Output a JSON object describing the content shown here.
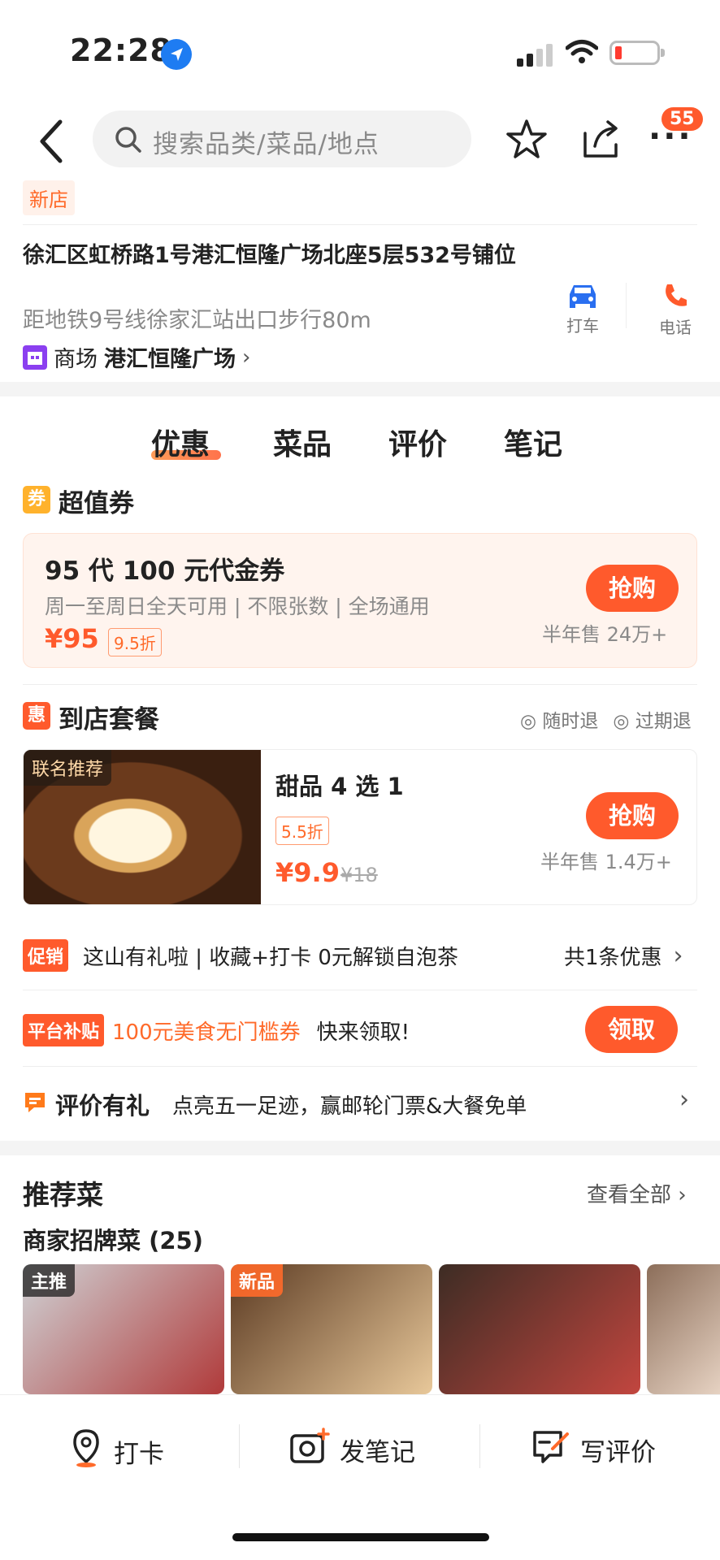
{
  "status": {
    "time": "22:28"
  },
  "header": {
    "search_placeholder": "搜索品类/菜品/地点",
    "more_badge": "55"
  },
  "store": {
    "new_tag": "新店",
    "address": "徐汇区虹桥路1号港汇恒隆广场北座5层532号铺位",
    "metro": "距地铁9号线徐家汇站出口步行80m",
    "mall_prefix": "商场",
    "mall_name": "港汇恒隆广场",
    "actions": {
      "taxi": "打车",
      "phone": "电话"
    }
  },
  "tabs": [
    {
      "label": "优惠",
      "active": true
    },
    {
      "label": "菜品"
    },
    {
      "label": "评价"
    },
    {
      "label": "笔记"
    }
  ],
  "voucher_section": {
    "icon": "券",
    "title": "超值券",
    "card": {
      "title": "95 代 100 元代金券",
      "desc": "周一至周日全天可用 | 不限张数 | 全场通用",
      "price": "¥95",
      "discount": "9.5折",
      "buy": "抢购",
      "sold": "半年售 24万+"
    }
  },
  "package_section": {
    "icon": "惠",
    "title": "到店套餐",
    "policies": [
      "随时退",
      "过期退"
    ],
    "card": {
      "tag": "联名推荐",
      "title": "甜品 4 选 1",
      "discount": "5.5折",
      "price": "¥9.9",
      "orig_price": "¥18",
      "buy": "抢购",
      "sold": "半年售 1.4万+"
    }
  },
  "promos": {
    "promo1": {
      "tag": "促销",
      "text": "这山有礼啦 | 收藏+打卡 0元解锁自泡茶",
      "right": "共1条优惠"
    },
    "promo2": {
      "tag": "平台补贴",
      "highlight": "100元美食无门槛券",
      "text": "快来领取!",
      "button": "领取"
    },
    "review": {
      "title": "评价有礼",
      "text": "点亮五一足迹，赢邮轮门票&大餐免单"
    }
  },
  "recommend": {
    "title": "推荐菜",
    "view_all": "查看全部",
    "signature": "商家招牌菜 (25)",
    "dishes": [
      {
        "tag": "主推",
        "colors": [
          "#cfd3d6",
          "#b03a3a"
        ]
      },
      {
        "tag": "新品",
        "colors": [
          "#5b3a22",
          "#e8c89a"
        ]
      },
      {
        "tag": "",
        "colors": [
          "#3d2c24",
          "#c2463f"
        ]
      },
      {
        "tag": "",
        "colors": [
          "#8c6e5a",
          "#e6d2c2"
        ]
      }
    ]
  },
  "bottom_bar": {
    "checkin": "打卡",
    "note": "发笔记",
    "review": "写评价"
  },
  "colors": {
    "accent": "#ff5a2c",
    "tag_bg": "#fff1ea"
  }
}
